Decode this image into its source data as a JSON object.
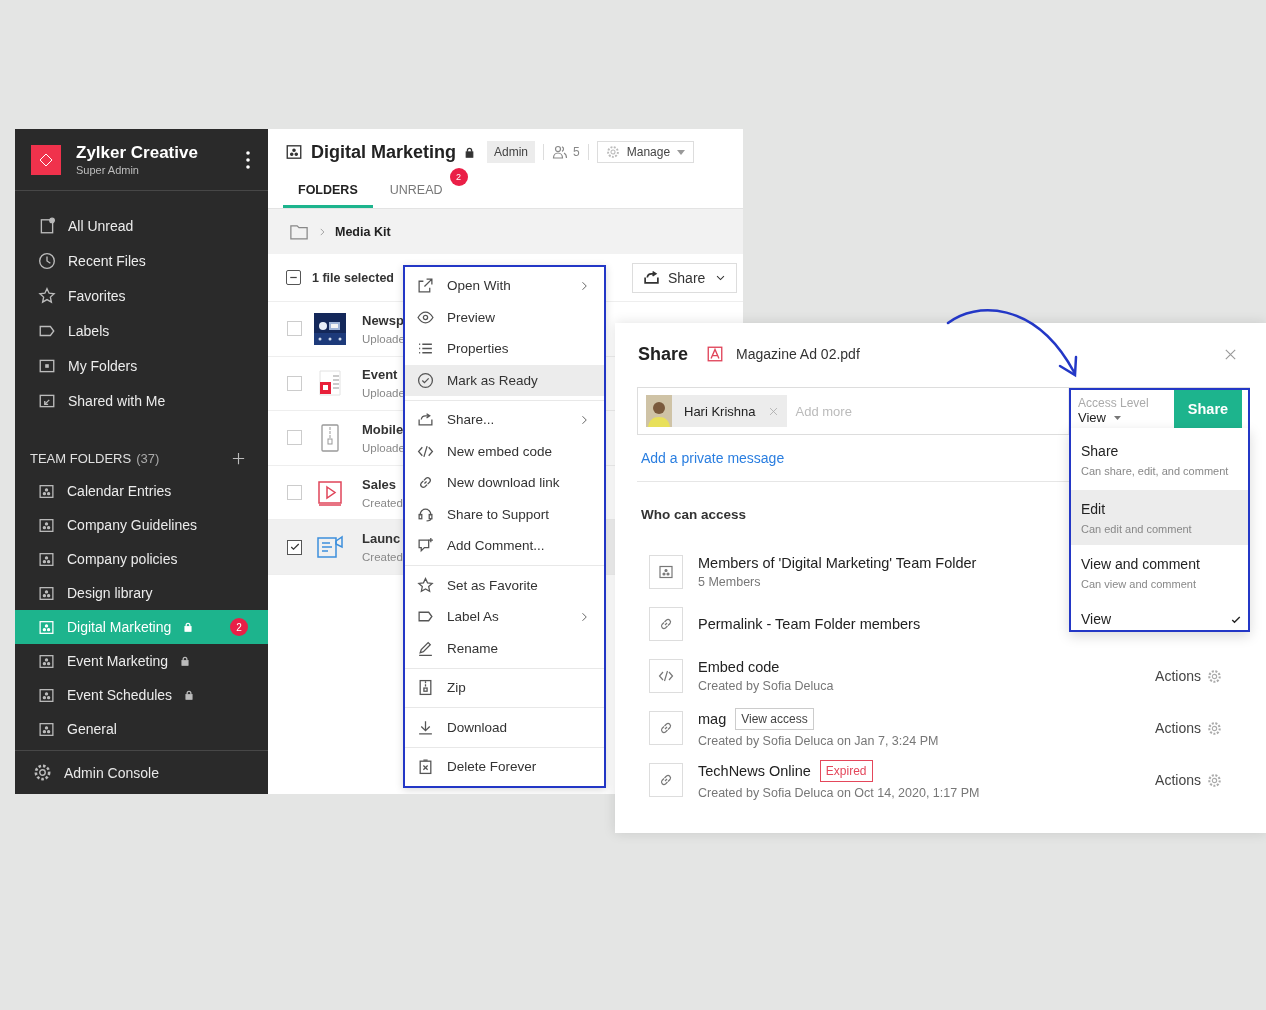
{
  "sidebar": {
    "org_name": "Zylker Creative",
    "role": "Super Admin",
    "nav_items": [
      {
        "label": "All Unread"
      },
      {
        "label": "Recent Files"
      },
      {
        "label": "Favorites"
      },
      {
        "label": "Labels"
      },
      {
        "label": "My Folders"
      },
      {
        "label": "Shared with Me"
      }
    ],
    "team_folders": {
      "heading": "TEAM FOLDERS",
      "count": "(37)",
      "items": [
        {
          "label": "Calendar Entries",
          "locked": false,
          "selected": false
        },
        {
          "label": "Company Guidelines",
          "locked": false,
          "selected": false
        },
        {
          "label": "Company policies",
          "locked": false,
          "selected": false
        },
        {
          "label": "Design library",
          "locked": false,
          "selected": false
        },
        {
          "label": "Digital Marketing",
          "locked": true,
          "selected": true,
          "badge": "2"
        },
        {
          "label": "Event Marketing",
          "locked": true,
          "selected": false
        },
        {
          "label": "Event Schedules",
          "locked": true,
          "selected": false
        },
        {
          "label": "General",
          "locked": false,
          "selected": false
        }
      ]
    },
    "footer": "Admin Console"
  },
  "folder": {
    "title": "Digital Marketing",
    "locked": true,
    "role": "Admin",
    "member_count": "5",
    "manage": "Manage",
    "tabs": [
      {
        "label": "FOLDERS",
        "selected": true
      },
      {
        "label": "UNREAD",
        "selected": false,
        "badge": "2"
      }
    ],
    "breadcrumb": "Media Kit",
    "select_all_indeterminate": true,
    "selection": "1 file selected",
    "share_button": "Share",
    "files": [
      {
        "name": "Newsp",
        "meta": "Uploade",
        "checked": false
      },
      {
        "name": "Event",
        "meta": "Uploade",
        "checked": false
      },
      {
        "name": "Mobile",
        "meta": "Uploade",
        "checked": false
      },
      {
        "name": "Sales",
        "meta": "Created",
        "checked": false
      },
      {
        "name": "Launc",
        "meta": "Created",
        "checked": true
      }
    ]
  },
  "context_menu": {
    "groups": [
      [
        {
          "label": "Open With",
          "submenu": true,
          "highlighted": false
        },
        {
          "label": "Preview",
          "submenu": false,
          "highlighted": false
        },
        {
          "label": "Properties",
          "submenu": false,
          "highlighted": false
        },
        {
          "label": "Mark as Ready",
          "submenu": false,
          "highlighted": true
        }
      ],
      [
        {
          "label": "Share...",
          "submenu": true,
          "highlighted": false
        },
        {
          "label": "New embed code",
          "submenu": false,
          "highlighted": false
        },
        {
          "label": "New download link",
          "submenu": false,
          "highlighted": false
        },
        {
          "label": "Share to Support",
          "submenu": false,
          "highlighted": false
        },
        {
          "label": "Add Comment...",
          "submenu": false,
          "highlighted": false
        }
      ],
      [
        {
          "label": "Set as Favorite",
          "submenu": false,
          "highlighted": false
        },
        {
          "label": "Label As",
          "submenu": true,
          "highlighted": false
        },
        {
          "label": "Rename",
          "submenu": false,
          "highlighted": false
        }
      ],
      [
        {
          "label": "Zip",
          "submenu": false,
          "highlighted": false
        }
      ],
      [
        {
          "label": "Download",
          "submenu": false,
          "highlighted": false
        }
      ],
      [
        {
          "label": "Delete Forever",
          "submenu": false,
          "highlighted": false
        }
      ]
    ]
  },
  "share_dialog": {
    "title": "Share",
    "file_name": "Magazine Ad 02.pdf",
    "recipients": [
      {
        "name": "Hari Krishna"
      }
    ],
    "recipient_placeholder": "Add more",
    "access_label": "Access Level",
    "access_value": "View",
    "share_button": "Share",
    "message_link": "Add a private message",
    "access_heading": "Who can access",
    "access_options": [
      {
        "label": "Share",
        "description": "Can share, edit, and comment",
        "highlighted": false,
        "checked": false
      },
      {
        "label": "Edit",
        "description": "Can edit and comment",
        "highlighted": true,
        "checked": false
      },
      {
        "label": "View and comment",
        "description": "Can view and comment",
        "highlighted": false,
        "checked": false
      },
      {
        "label": "View",
        "highlighted": false,
        "checked": true
      }
    ],
    "entries": [
      {
        "kind": "team",
        "title": "Members of 'Digital Marketing' Team Folder",
        "subtitle": "5 Members"
      },
      {
        "kind": "link",
        "title": "Permalink - Team Folder members"
      },
      {
        "kind": "embed",
        "title": "Embed code",
        "subtitle": "Created by Sofia Deluca",
        "actions": "Actions"
      },
      {
        "kind": "link",
        "title": "mag",
        "tag": {
          "label": "View access",
          "kind": "info"
        },
        "subtitle": "Created by Sofia Deluca on Jan 7, 3:24 PM",
        "actions": "Actions"
      },
      {
        "kind": "link",
        "title": "TechNews Online",
        "tag": {
          "label": "Expired",
          "kind": "expired"
        },
        "subtitle": "Created by Sofia Deluca on Oct 14, 2020, 1:17 PM",
        "actions": "Actions"
      }
    ]
  }
}
